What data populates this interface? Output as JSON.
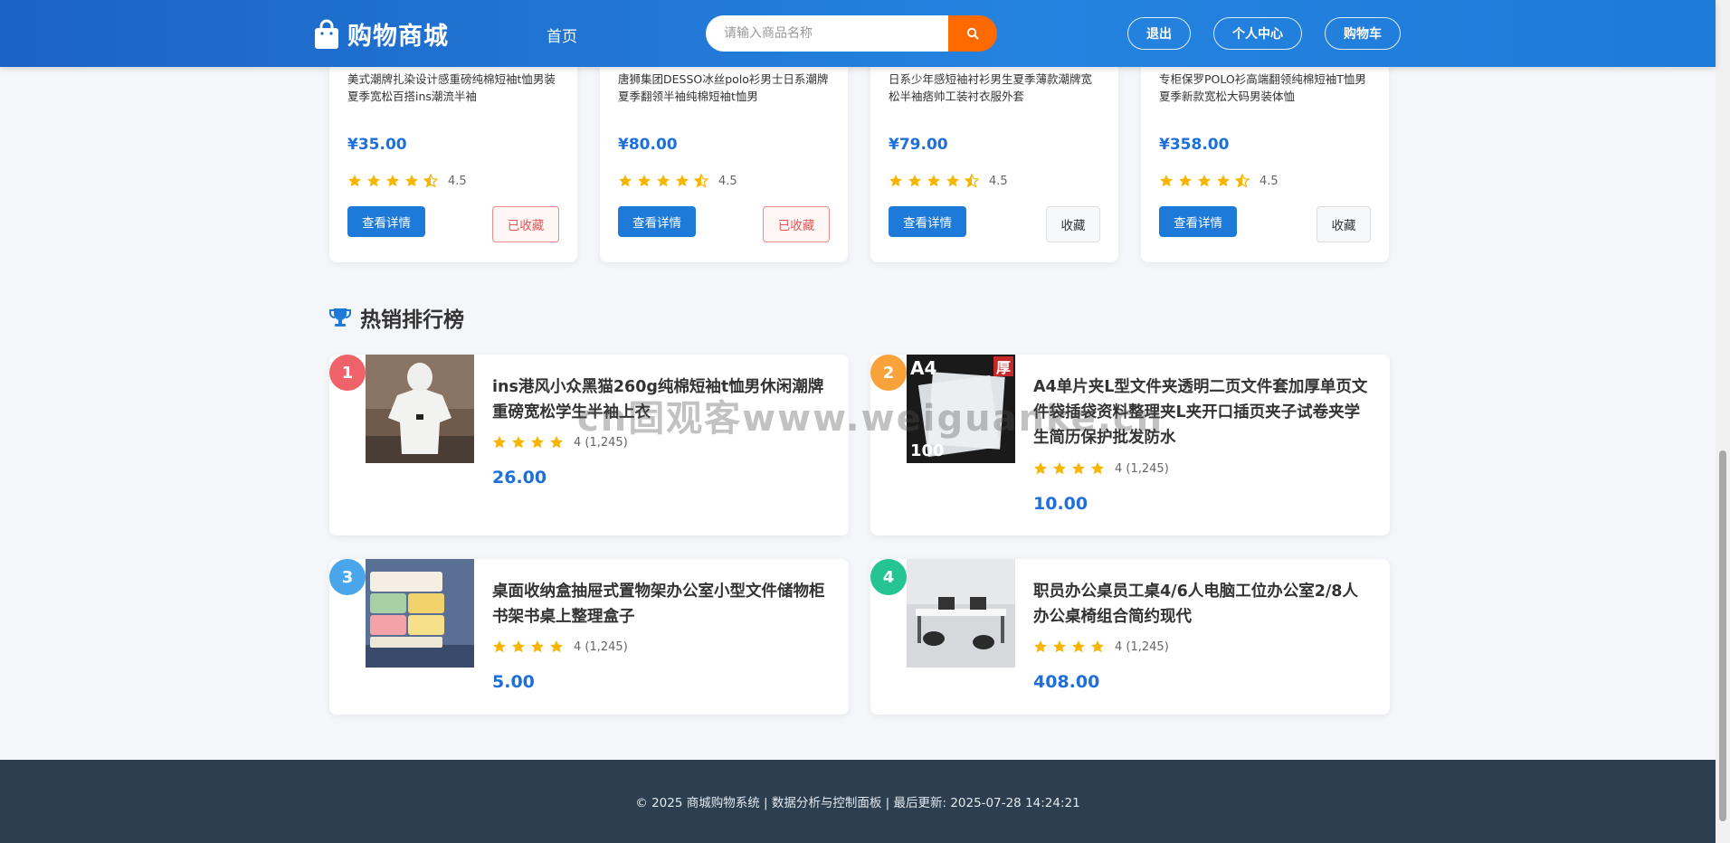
{
  "header": {
    "logo_text": "购物商城",
    "nav_home": "首页",
    "search_placeholder": "请输入商品名称",
    "logout": "退出",
    "profile": "个人中心",
    "cart": "购物车"
  },
  "products": [
    {
      "title": "美式潮牌扎染设计感重磅纯棉短袖t恤男装夏季宽松百搭ins潮流半袖",
      "price": "¥35.00",
      "rating": "4.5",
      "rating_value": 4.5,
      "detail_label": "查看详情",
      "fav_label": "已收藏",
      "favorited": true
    },
    {
      "title": "唐狮集团DESSO冰丝polo衫男士日系潮牌夏季翻领半袖纯棉短袖t恤男",
      "price": "¥80.00",
      "rating": "4.5",
      "rating_value": 4.5,
      "detail_label": "查看详情",
      "fav_label": "已收藏",
      "favorited": true
    },
    {
      "title": "日系少年感短袖衬衫男生夏季薄款潮牌宽松半袖痞帅工装衬衣服外套",
      "price": "¥79.00",
      "rating": "4.5",
      "rating_value": 4.5,
      "detail_label": "查看详情",
      "fav_label": "收藏",
      "favorited": false
    },
    {
      "title": "专柜保罗POLO衫高端翻领纯棉短袖T恤男夏季新款宽松大码男装体恤",
      "price": "¥358.00",
      "rating": "4.5",
      "rating_value": 4.5,
      "detail_label": "查看详情",
      "fav_label": "收藏",
      "favorited": false
    }
  ],
  "ranking": {
    "title": "热销排行榜",
    "items": [
      {
        "rank": "1",
        "title": "ins港风小众黑猫260g纯棉短袖t恤男休闲潮牌重磅宽松学生半袖上衣",
        "rating": "4 (1,245)",
        "rating_value": 4,
        "price": "26.00",
        "badge_color": "#f0626a"
      },
      {
        "rank": "2",
        "title": "A4单片夹L型文件夹透明二页文件套加厚单页文件袋插袋资料整理夹L夹开口插页夹子试卷夹学生简历保护批发防水",
        "rating": "4 (1,245)",
        "rating_value": 4,
        "price": "10.00",
        "badge_color": "#f7a23b"
      },
      {
        "rank": "3",
        "title": "桌面收纳盒抽屉式置物架办公室小型文件储物柜书架书桌上整理盒子",
        "rating": "4 (1,245)",
        "rating_value": 4,
        "price": "5.00",
        "badge_color": "#4aa6ea"
      },
      {
        "rank": "4",
        "title": "职员办公桌员工桌4/6人电脑工位办公室2/8人办公桌椅组合简约现代",
        "rating": "4 (1,245)",
        "rating_value": 4,
        "price": "408.00",
        "badge_color": "#27c493"
      }
    ]
  },
  "image2_text": {
    "a4": "A4",
    "thick": "厚",
    "hundred": "100"
  },
  "watermark": "cn固观客www.weiguanke.cn",
  "footer": "© 2025 商城购物系统 | 数据分析与控制面板 | 最后更新: 2025-07-28 14:24:21",
  "colors": {
    "primary": "#1e7ad8",
    "accent": "#ff6a00",
    "star": "#f7b500",
    "footer_bg": "#2c3e50"
  }
}
